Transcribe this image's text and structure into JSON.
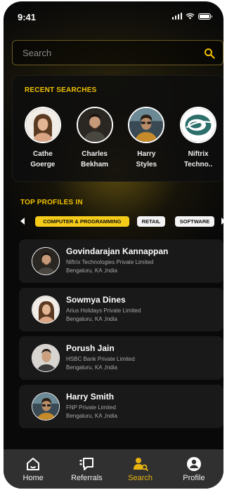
{
  "status_bar": {
    "time": "9:41"
  },
  "search": {
    "placeholder": "Search"
  },
  "recent_searches": {
    "title": "RECENT SEARCHES",
    "items": [
      {
        "name": "Cathe\nGoerge",
        "type": "person"
      },
      {
        "name": "Charles\nBekham",
        "type": "person"
      },
      {
        "name": "Harry\nStyles",
        "type": "person"
      },
      {
        "name": "Niftrix\nTechno..",
        "type": "company"
      }
    ]
  },
  "top_profiles": {
    "title": "TOP PROFILES IN",
    "categories": [
      {
        "label": "COMPUTER & PROGRAMMING",
        "active": true
      },
      {
        "label": "RETAIL",
        "active": false
      },
      {
        "label": "SOFTWARE",
        "active": false
      }
    ],
    "profiles": [
      {
        "name": "Govindarajan Kannappan",
        "company": "Niftrix Technologies Private Limited",
        "location": "Bengaluru, KA ,India"
      },
      {
        "name": "Sowmya Dines",
        "company": "Arius Holidays Private Limited",
        "location": "Bengaluru, KA ,India"
      },
      {
        "name": "Porush Jain",
        "company": "HSBC Bank Private Limited",
        "location": "Bengaluru, KA ,India"
      },
      {
        "name": "Harry Smith",
        "company": "FNP Private Limited",
        "location": "Bengaluru, KA ,India"
      }
    ]
  },
  "bottom_nav": {
    "items": [
      {
        "label": "Home",
        "icon": "home-icon"
      },
      {
        "label": "Referrals",
        "icon": "referrals-icon"
      },
      {
        "label": "Search",
        "icon": "search-people-icon",
        "active": true
      },
      {
        "label": "Profile",
        "icon": "profile-icon"
      }
    ]
  },
  "colors": {
    "accent": "#f2c200",
    "background": "#090909",
    "card": "#1a1a1a",
    "nav": "#303030"
  }
}
